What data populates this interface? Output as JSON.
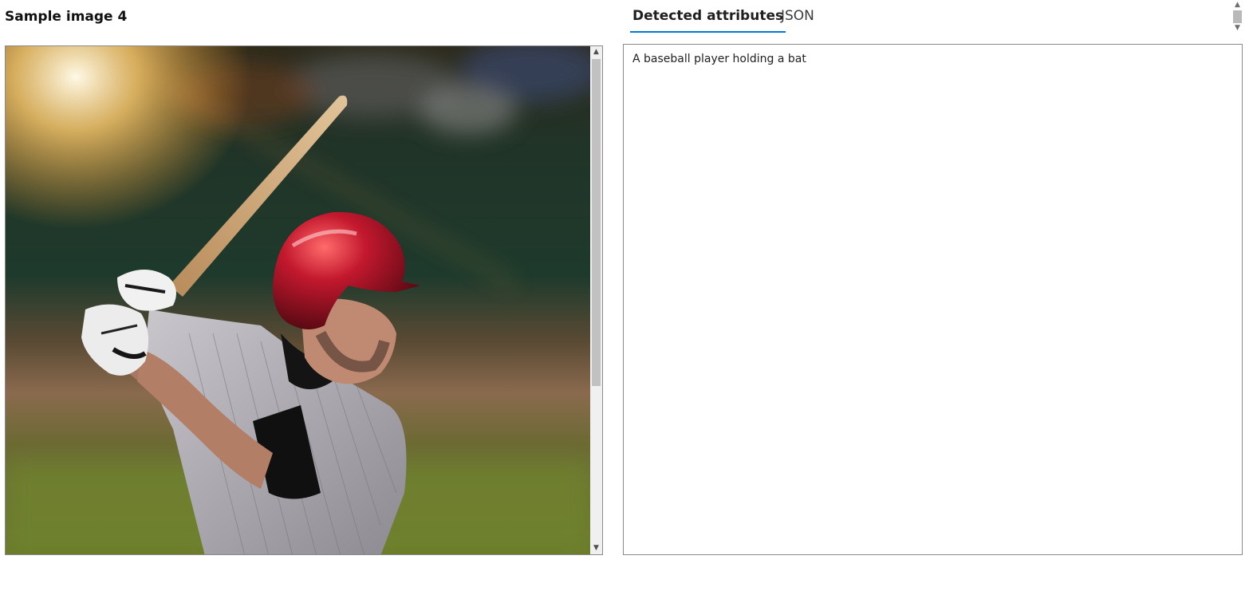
{
  "page": {
    "title": "Sample image 4"
  },
  "image": {
    "alt": "A baseball player holding a bat"
  },
  "tabs": [
    {
      "label": "Detected attributes",
      "active": true
    },
    {
      "label": "JSON",
      "active": false
    }
  ],
  "results": {
    "caption": "A baseball player holding a bat"
  },
  "colors": {
    "accent": "#0078d4",
    "helmet": "#b3122a",
    "field": "#6f7d30"
  }
}
